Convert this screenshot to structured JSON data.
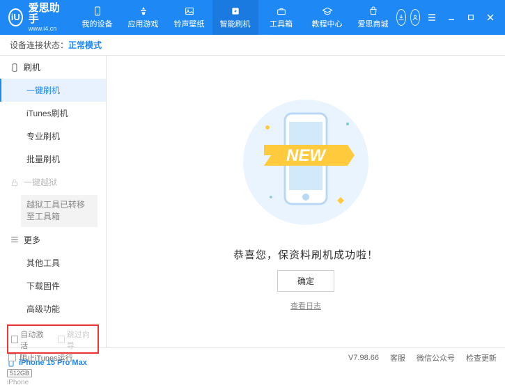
{
  "app": {
    "name": "爱思助手",
    "url": "www.i4.cn",
    "logo_letter": "iU"
  },
  "nav": {
    "items": [
      {
        "label": "我的设备"
      },
      {
        "label": "应用游戏"
      },
      {
        "label": "铃声壁纸"
      },
      {
        "label": "智能刷机"
      },
      {
        "label": "工具箱"
      },
      {
        "label": "教程中心"
      },
      {
        "label": "爱思商城"
      }
    ]
  },
  "status": {
    "prefix": "设备连接状态：",
    "mode": "正常模式"
  },
  "sidebar": {
    "flash_section": "刷机",
    "items_flash": [
      {
        "label": "一键刷机"
      },
      {
        "label": "iTunes刷机"
      },
      {
        "label": "专业刷机"
      },
      {
        "label": "批量刷机"
      }
    ],
    "jailbreak_section": "一键越狱",
    "jailbreak_note": "越狱工具已转移至工具箱",
    "more_section": "更多",
    "items_more": [
      {
        "label": "其他工具"
      },
      {
        "label": "下载固件"
      },
      {
        "label": "高级功能"
      }
    ],
    "auto_activate": "自动激活",
    "skip_guide": "跳过向导",
    "device_name": "iPhone 15 Pro Max",
    "device_storage": "512GB",
    "device_type": "iPhone"
  },
  "main": {
    "new_ribbon": "NEW",
    "success_text": "恭喜您，保资料刷机成功啦！",
    "ok_button": "确定",
    "view_log": "查看日志"
  },
  "footer": {
    "block_itunes": "阻止iTunes运行",
    "version": "V7.98.66",
    "service": "客服",
    "wechat": "微信公众号",
    "update": "检查更新"
  }
}
